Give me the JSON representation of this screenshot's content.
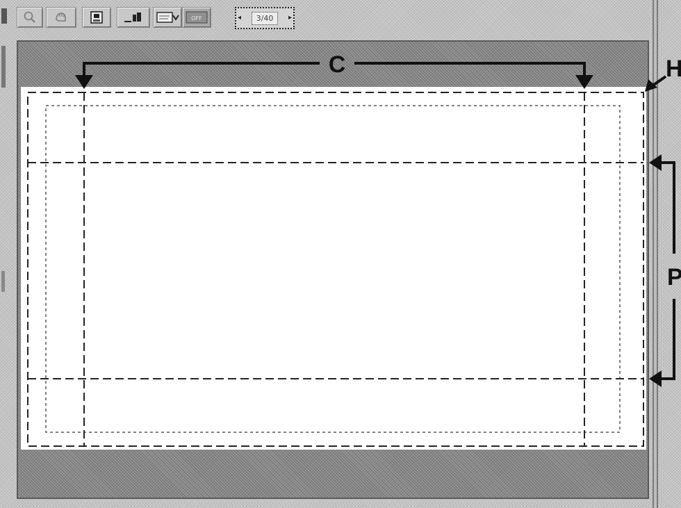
{
  "toolbar": {
    "buttons": [
      {
        "icon": "magnifier-icon"
      },
      {
        "icon": "hand-icon"
      },
      {
        "icon": "print-icon"
      },
      {
        "icon": "export-icon"
      },
      {
        "icon": "dropdown-icon"
      },
      {
        "icon": "off-icon",
        "label": "OFF"
      }
    ],
    "page_indicator": {
      "value": "3/40"
    }
  },
  "callouts": {
    "c": "C",
    "h": "H",
    "p": "P"
  }
}
